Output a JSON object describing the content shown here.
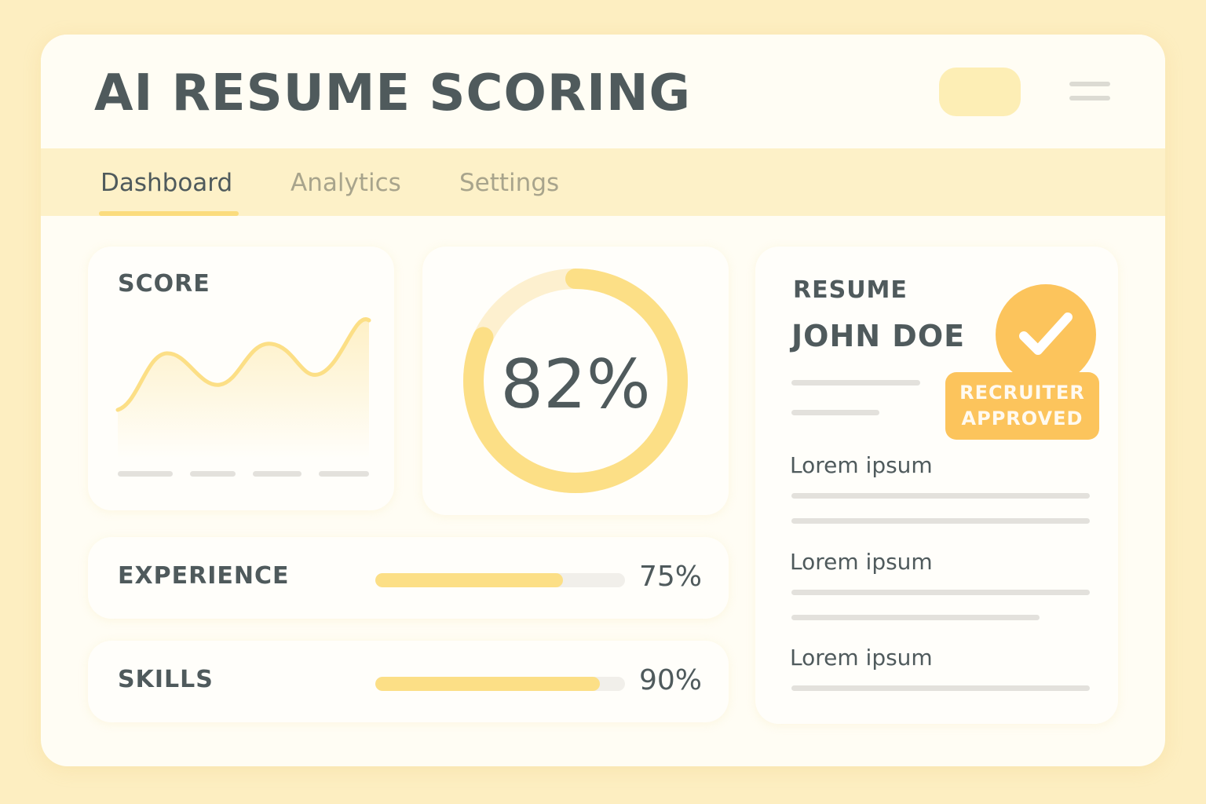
{
  "header": {
    "title": "AI RESUME SCORING"
  },
  "tabs": [
    {
      "label": "Dashboard",
      "active": true
    },
    {
      "label": "Analytics",
      "active": false
    },
    {
      "label": "Settings",
      "active": false
    }
  ],
  "score_card": {
    "label": "SCORE"
  },
  "overall": {
    "value_text": "82%",
    "value": 82
  },
  "metrics": [
    {
      "label": "EXPERIENCE",
      "value_text": "75%",
      "value": 75
    },
    {
      "label": "SKILLS",
      "value_text": "90%",
      "value": 90
    }
  ],
  "resume": {
    "label": "RESUME",
    "name": "JOHN DOE",
    "badge_line1": "RECRUITER",
    "badge_line2": "APPROVED",
    "sections": [
      {
        "title": "Lorem ipsum"
      },
      {
        "title": "Lorem ipsum"
      },
      {
        "title": "Lorem ipsum"
      }
    ]
  },
  "colors": {
    "accent": "#fcdf86",
    "badge": "#fcc45c",
    "text": "#4f5a5c",
    "background": "#fdeec1"
  },
  "icons": {
    "menu": "hamburger-icon",
    "approved": "checkmark-icon"
  }
}
